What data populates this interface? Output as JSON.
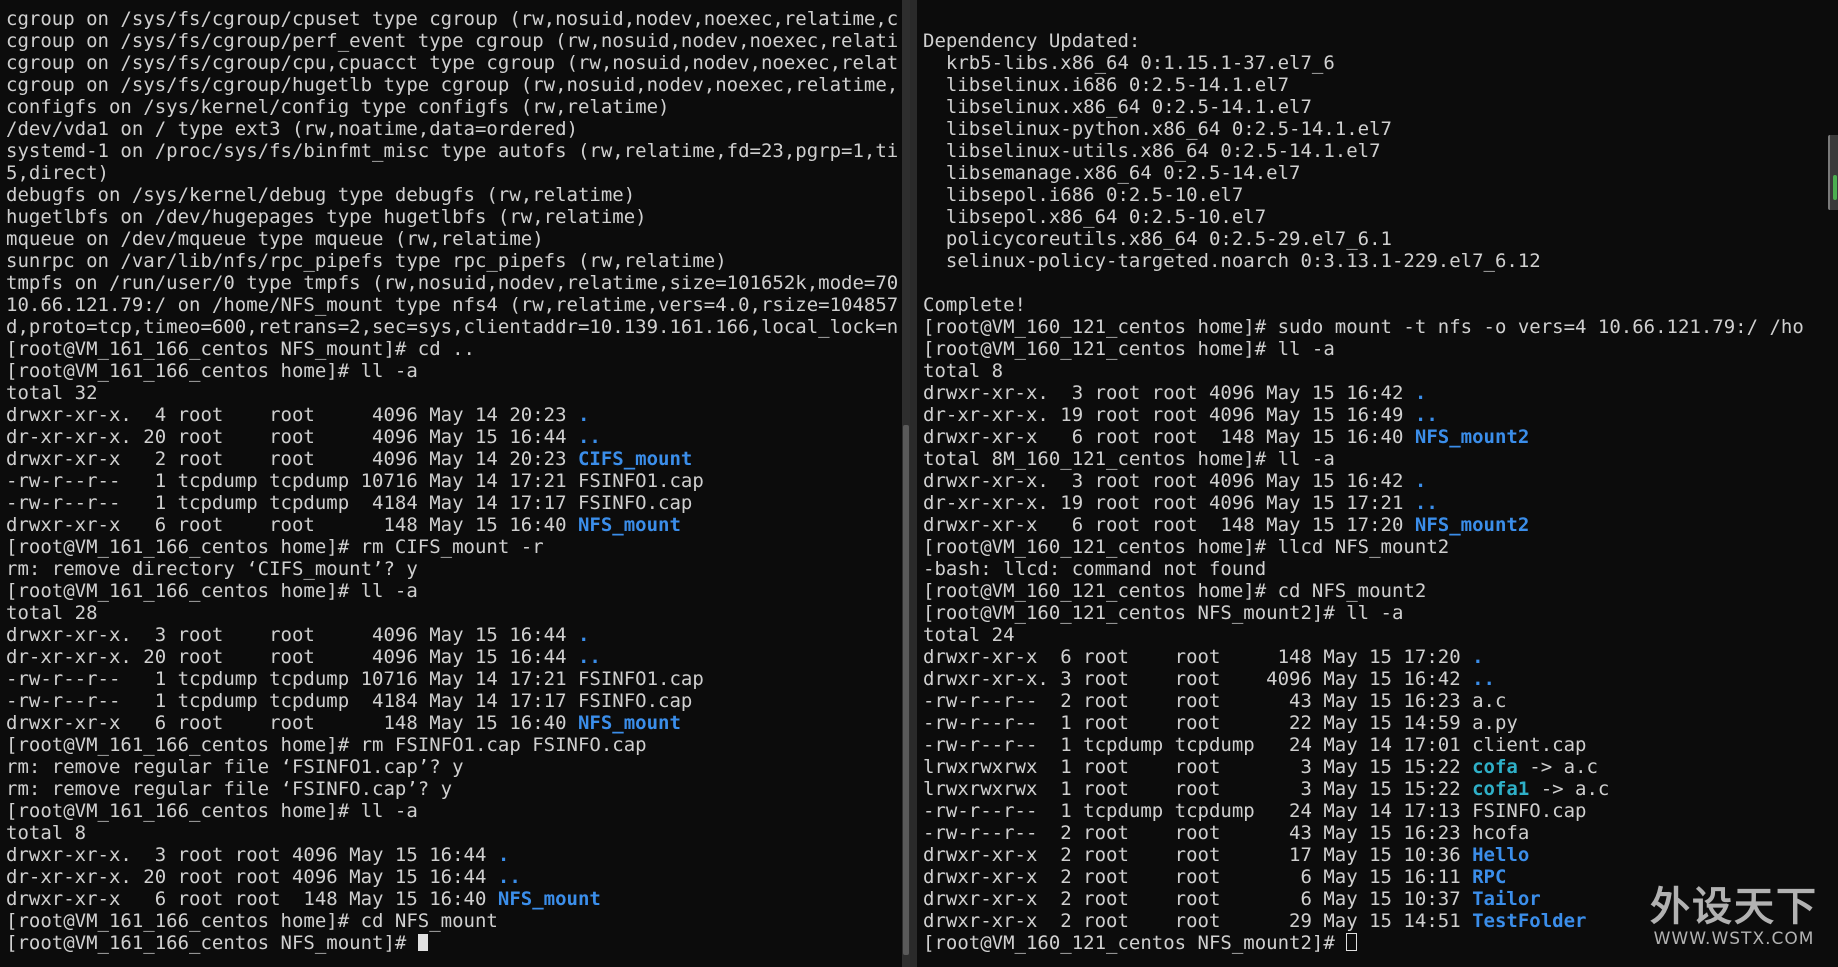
{
  "left": {
    "lines": [
      [
        {
          "t": "cgroup on /sys/fs/cgroup/cpuset type cgroup (rw,nosuid,nodev,noexec,relatime,c"
        }
      ],
      [
        {
          "t": "cgroup on /sys/fs/cgroup/perf_event type cgroup (rw,nosuid,nodev,noexec,relati"
        }
      ],
      [
        {
          "t": "cgroup on /sys/fs/cgroup/cpu,cpuacct type cgroup (rw,nosuid,nodev,noexec,relat"
        }
      ],
      [
        {
          "t": "cgroup on /sys/fs/cgroup/hugetlb type cgroup (rw,nosuid,nodev,noexec,relatime,"
        }
      ],
      [
        {
          "t": "configfs on /sys/kernel/config type configfs (rw,relatime)"
        }
      ],
      [
        {
          "t": "/dev/vda1 on / type ext3 (rw,noatime,data=ordered)"
        }
      ],
      [
        {
          "t": "systemd-1 on /proc/sys/fs/binfmt_misc type autofs (rw,relatime,fd=23,pgrp=1,ti"
        }
      ],
      [
        {
          "t": "5,direct)"
        }
      ],
      [
        {
          "t": "debugfs on /sys/kernel/debug type debugfs (rw,relatime)"
        }
      ],
      [
        {
          "t": "hugetlbfs on /dev/hugepages type hugetlbfs (rw,relatime)"
        }
      ],
      [
        {
          "t": "mqueue on /dev/mqueue type mqueue (rw,relatime)"
        }
      ],
      [
        {
          "t": "sunrpc on /var/lib/nfs/rpc_pipefs type rpc_pipefs (rw,relatime)"
        }
      ],
      [
        {
          "t": "tmpfs on /run/user/0 type tmpfs (rw,nosuid,nodev,relatime,size=101652k,mode=70"
        }
      ],
      [
        {
          "t": "10.66.121.79:/ on /home/NFS_mount type nfs4 (rw,relatime,vers=4.0,rsize=104857"
        }
      ],
      [
        {
          "t": "d,proto=tcp,timeo=600,retrans=2,sec=sys,clientaddr=10.139.161.166,local_lock=n"
        }
      ],
      [
        {
          "t": "[root@VM_161_166_centos NFS_mount]# cd .."
        }
      ],
      [
        {
          "t": "[root@VM_161_166_centos home]# ll -a"
        }
      ],
      [
        {
          "t": "total 32"
        }
      ],
      [
        {
          "t": "drwxr-xr-x.  4 root    root     4096 May 14 20:23 "
        },
        {
          "t": ".",
          "c": "dir"
        }
      ],
      [
        {
          "t": "dr-xr-xr-x. 20 root    root     4096 May 15 16:44 "
        },
        {
          "t": "..",
          "c": "dir"
        }
      ],
      [
        {
          "t": "drwxr-xr-x   2 root    root     4096 May 14 20:23 "
        },
        {
          "t": "CIFS_mount",
          "c": "dir"
        }
      ],
      [
        {
          "t": "-rw-r--r--   1 tcpdump tcpdump 10716 May 14 17:21 FSINFO1.cap"
        }
      ],
      [
        {
          "t": "-rw-r--r--   1 tcpdump tcpdump  4184 May 14 17:17 FSINFO.cap"
        }
      ],
      [
        {
          "t": "drwxr-xr-x   6 root    root      148 May 15 16:40 "
        },
        {
          "t": "NFS_mount",
          "c": "dir"
        }
      ],
      [
        {
          "t": "[root@VM_161_166_centos home]# rm CIFS_mount -r"
        }
      ],
      [
        {
          "t": "rm: remove directory ‘CIFS_mount’? y"
        }
      ],
      [
        {
          "t": "[root@VM_161_166_centos home]# ll -a"
        }
      ],
      [
        {
          "t": "total 28"
        }
      ],
      [
        {
          "t": "drwxr-xr-x.  3 root    root     4096 May 15 16:44 "
        },
        {
          "t": ".",
          "c": "dir"
        }
      ],
      [
        {
          "t": "dr-xr-xr-x. 20 root    root     4096 May 15 16:44 "
        },
        {
          "t": "..",
          "c": "dir"
        }
      ],
      [
        {
          "t": "-rw-r--r--   1 tcpdump tcpdump 10716 May 14 17:21 FSINFO1.cap"
        }
      ],
      [
        {
          "t": "-rw-r--r--   1 tcpdump tcpdump  4184 May 14 17:17 FSINFO.cap"
        }
      ],
      [
        {
          "t": "drwxr-xr-x   6 root    root      148 May 15 16:40 "
        },
        {
          "t": "NFS_mount",
          "c": "dir"
        }
      ],
      [
        {
          "t": "[root@VM_161_166_centos home]# rm FSINFO1.cap FSINFO.cap"
        }
      ],
      [
        {
          "t": "rm: remove regular file ‘FSINFO1.cap’? y"
        }
      ],
      [
        {
          "t": "rm: remove regular file ‘FSINFO.cap’? y"
        }
      ],
      [
        {
          "t": "[root@VM_161_166_centos home]# ll -a"
        }
      ],
      [
        {
          "t": "total 8"
        }
      ],
      [
        {
          "t": "drwxr-xr-x.  3 root root 4096 May 15 16:44 "
        },
        {
          "t": ".",
          "c": "dir"
        }
      ],
      [
        {
          "t": "dr-xr-xr-x. 20 root root 4096 May 15 16:44 "
        },
        {
          "t": "..",
          "c": "dir"
        }
      ],
      [
        {
          "t": "drwxr-xr-x   6 root root  148 May 15 16:40 "
        },
        {
          "t": "NFS_mount",
          "c": "dir"
        }
      ],
      [
        {
          "t": "[root@VM_161_166_centos home]# cd NFS_mount"
        }
      ],
      [
        {
          "t": "[root@VM_161_166_centos NFS_mount]# "
        },
        {
          "cursor": "solid"
        }
      ]
    ]
  },
  "right": {
    "lines": [
      [
        {
          "t": ""
        }
      ],
      [
        {
          "t": "Dependency Updated:"
        }
      ],
      [
        {
          "t": "  krb5-libs.x86_64 0:1.15.1-37.el7_6"
        }
      ],
      [
        {
          "t": "  libselinux.i686 0:2.5-14.1.el7"
        }
      ],
      [
        {
          "t": "  libselinux.x86_64 0:2.5-14.1.el7"
        }
      ],
      [
        {
          "t": "  libselinux-python.x86_64 0:2.5-14.1.el7"
        }
      ],
      [
        {
          "t": "  libselinux-utils.x86_64 0:2.5-14.1.el7"
        }
      ],
      [
        {
          "t": "  libsemanage.x86_64 0:2.5-14.el7"
        }
      ],
      [
        {
          "t": "  libsepol.i686 0:2.5-10.el7"
        }
      ],
      [
        {
          "t": "  libsepol.x86_64 0:2.5-10.el7"
        }
      ],
      [
        {
          "t": "  policycoreutils.x86_64 0:2.5-29.el7_6.1"
        }
      ],
      [
        {
          "t": "  selinux-policy-targeted.noarch 0:3.13.1-229.el7_6.12"
        }
      ],
      [
        {
          "t": ""
        }
      ],
      [
        {
          "t": "Complete!"
        }
      ],
      [
        {
          "t": "[root@VM_160_121_centos home]# sudo mount -t nfs -o vers=4 10.66.121.79:/ /ho"
        }
      ],
      [
        {
          "t": "[root@VM_160_121_centos home]# ll -a"
        }
      ],
      [
        {
          "t": "total 8"
        }
      ],
      [
        {
          "t": "drwxr-xr-x.  3 root root 4096 May 15 16:42 "
        },
        {
          "t": ".",
          "c": "dir"
        }
      ],
      [
        {
          "t": "dr-xr-xr-x. 19 root root 4096 May 15 16:49 "
        },
        {
          "t": "..",
          "c": "dir"
        }
      ],
      [
        {
          "t": "drwxr-xr-x   6 root root  148 May 15 16:40 "
        },
        {
          "t": "NFS_mount2",
          "c": "dir"
        }
      ],
      [
        {
          "t": "total 8M_160_121_centos home]# ll -a"
        }
      ],
      [
        {
          "t": "drwxr-xr-x.  3 root root 4096 May 15 16:42 "
        },
        {
          "t": ".",
          "c": "dir"
        }
      ],
      [
        {
          "t": "dr-xr-xr-x. 19 root root 4096 May 15 17:21 "
        },
        {
          "t": "..",
          "c": "dir"
        }
      ],
      [
        {
          "t": "drwxr-xr-x   6 root root  148 May 15 17:20 "
        },
        {
          "t": "NFS_mount2",
          "c": "dir"
        }
      ],
      [
        {
          "t": "[root@VM_160_121_centos home]# llcd NFS_mount2"
        }
      ],
      [
        {
          "t": "-bash: llcd: command not found"
        }
      ],
      [
        {
          "t": "[root@VM_160_121_centos home]# cd NFS_mount2"
        }
      ],
      [
        {
          "t": "[root@VM_160_121_centos NFS_mount2]# ll -a"
        }
      ],
      [
        {
          "t": "total 24"
        }
      ],
      [
        {
          "t": "drwxr-xr-x  6 root    root     148 May 15 17:20 "
        },
        {
          "t": ".",
          "c": "dir"
        }
      ],
      [
        {
          "t": "drwxr-xr-x. 3 root    root    4096 May 15 16:42 "
        },
        {
          "t": "..",
          "c": "dir"
        }
      ],
      [
        {
          "t": "-rw-r--r--  2 root    root      43 May 15 16:23 a.c"
        }
      ],
      [
        {
          "t": "-rw-r--r--  1 root    root      22 May 15 14:59 a.py"
        }
      ],
      [
        {
          "t": "-rw-r--r--  1 tcpdump tcpdump   24 May 14 17:01 client.cap"
        }
      ],
      [
        {
          "t": "lrwxrwxrwx  1 root    root       3 May 15 15:22 "
        },
        {
          "t": "cofa",
          "c": "lnk"
        },
        {
          "t": " -> a.c"
        }
      ],
      [
        {
          "t": "lrwxrwxrwx  1 root    root       3 May 15 15:22 "
        },
        {
          "t": "cofa1",
          "c": "lnk"
        },
        {
          "t": " -> a.c"
        }
      ],
      [
        {
          "t": "-rw-r--r--  1 tcpdump tcpdump   24 May 14 17:13 FSINFO.cap"
        }
      ],
      [
        {
          "t": "-rw-r--r--  2 root    root      43 May 15 16:23 hcofa"
        }
      ],
      [
        {
          "t": "drwxr-xr-x  2 root    root      17 May 15 10:36 "
        },
        {
          "t": "Hello",
          "c": "dir"
        }
      ],
      [
        {
          "t": "drwxr-xr-x  2 root    root       6 May 15 16:11 "
        },
        {
          "t": "RPC",
          "c": "dir"
        }
      ],
      [
        {
          "t": "drwxr-xr-x  2 root    root       6 May 15 10:37 "
        },
        {
          "t": "Tailor",
          "c": "dir"
        }
      ],
      [
        {
          "t": "drwxr-xr-x  2 root    root      29 May 15 14:51 "
        },
        {
          "t": "TestFolder",
          "c": "dir"
        }
      ],
      [
        {
          "t": "[root@VM_160_121_centos NFS_mount2]# "
        },
        {
          "cursor": "hollow"
        }
      ]
    ]
  },
  "watermark": {
    "main": "外设天下",
    "sub": "WWW.WSTX.COM"
  },
  "colors": {
    "background": "#0c0c0c",
    "text": "#d0d0d0",
    "directory": "#3b8eea",
    "symlink": "#2fb0c8"
  }
}
